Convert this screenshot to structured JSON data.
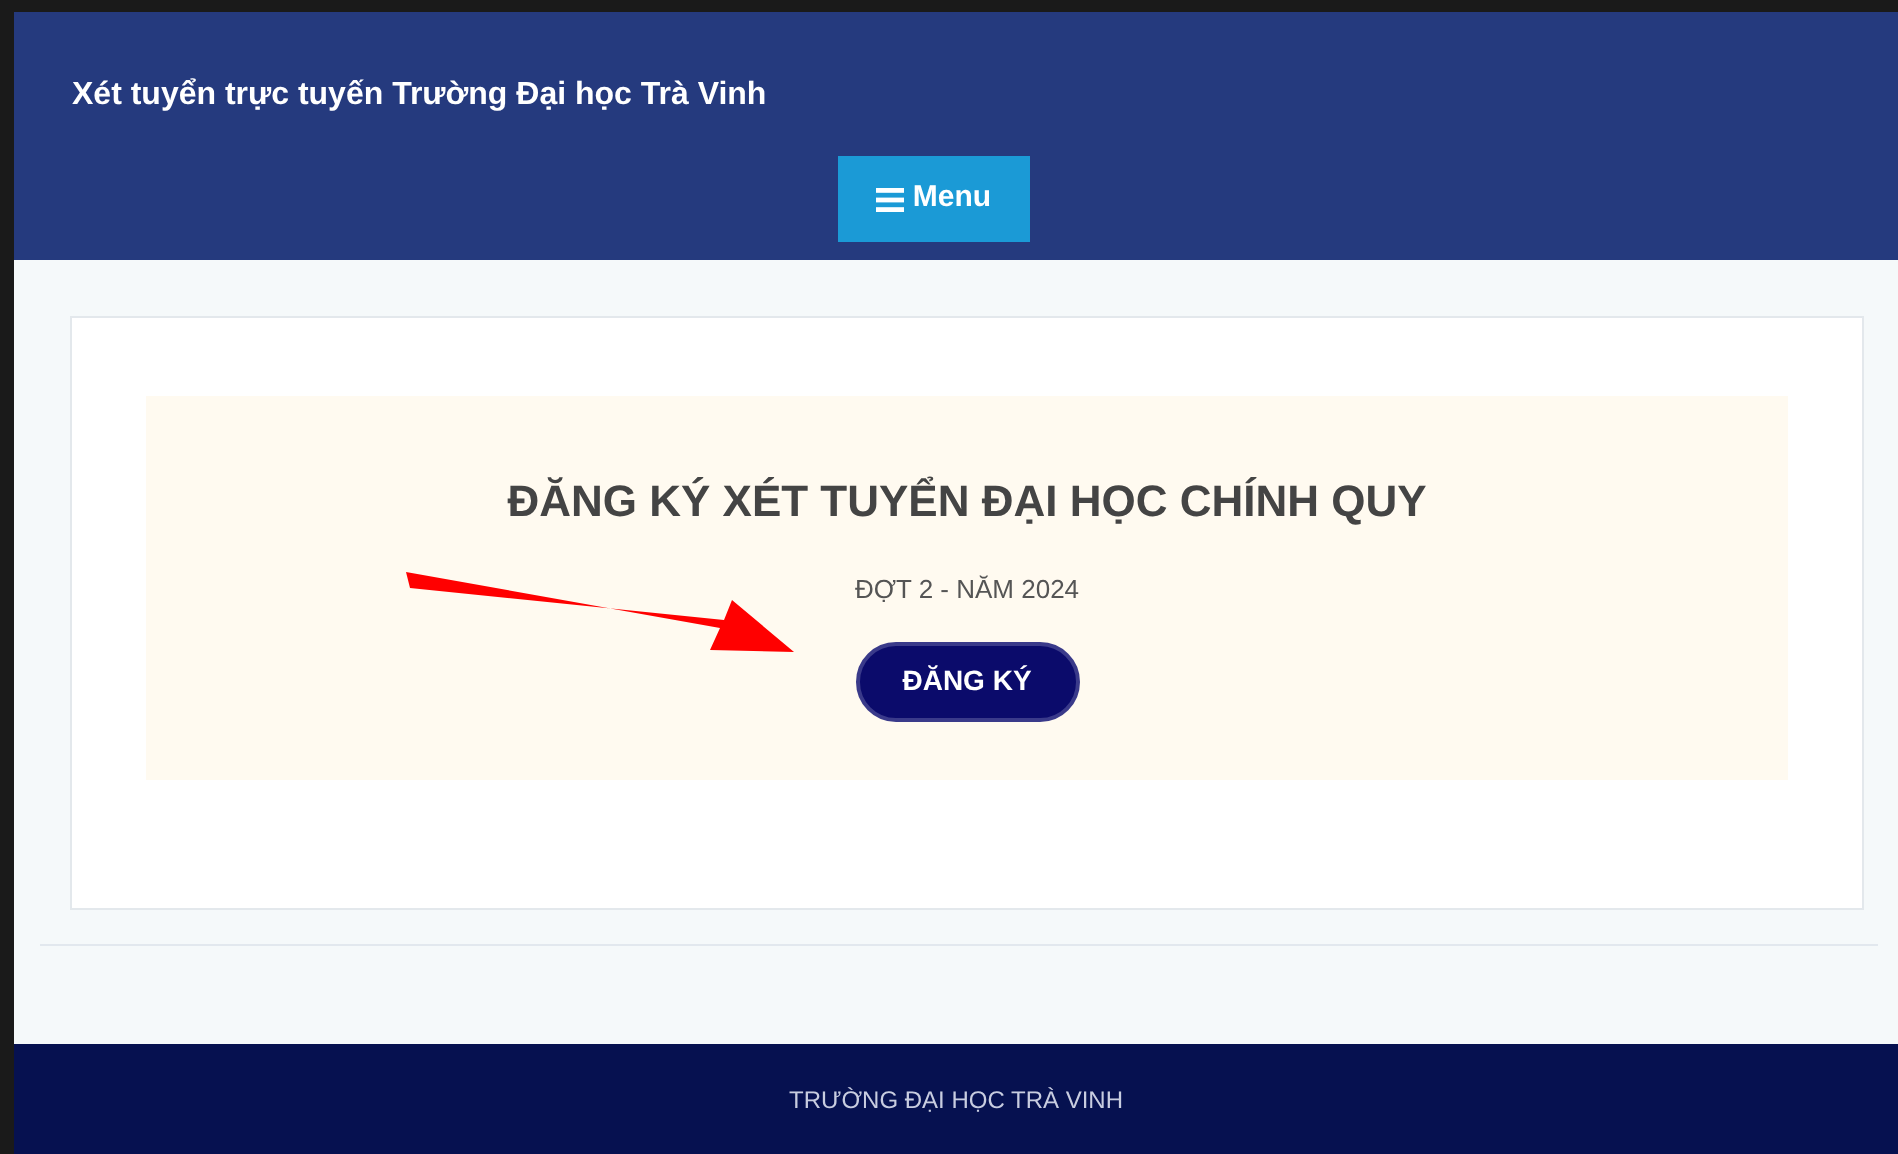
{
  "header": {
    "site_title": "Xét tuyển trực tuyến Trường Đại học Trà Vinh",
    "menu_button": "Menu"
  },
  "banner": {
    "title": "ĐĂNG KÝ XÉT TUYỂN ĐẠI HỌC CHÍNH QUY",
    "subtitle": "ĐỢT 2 - NĂM 2024",
    "register_button": "ĐĂNG KÝ"
  },
  "footer": {
    "text": "TRƯỜNG ĐẠI HỌC TRÀ VINH"
  }
}
